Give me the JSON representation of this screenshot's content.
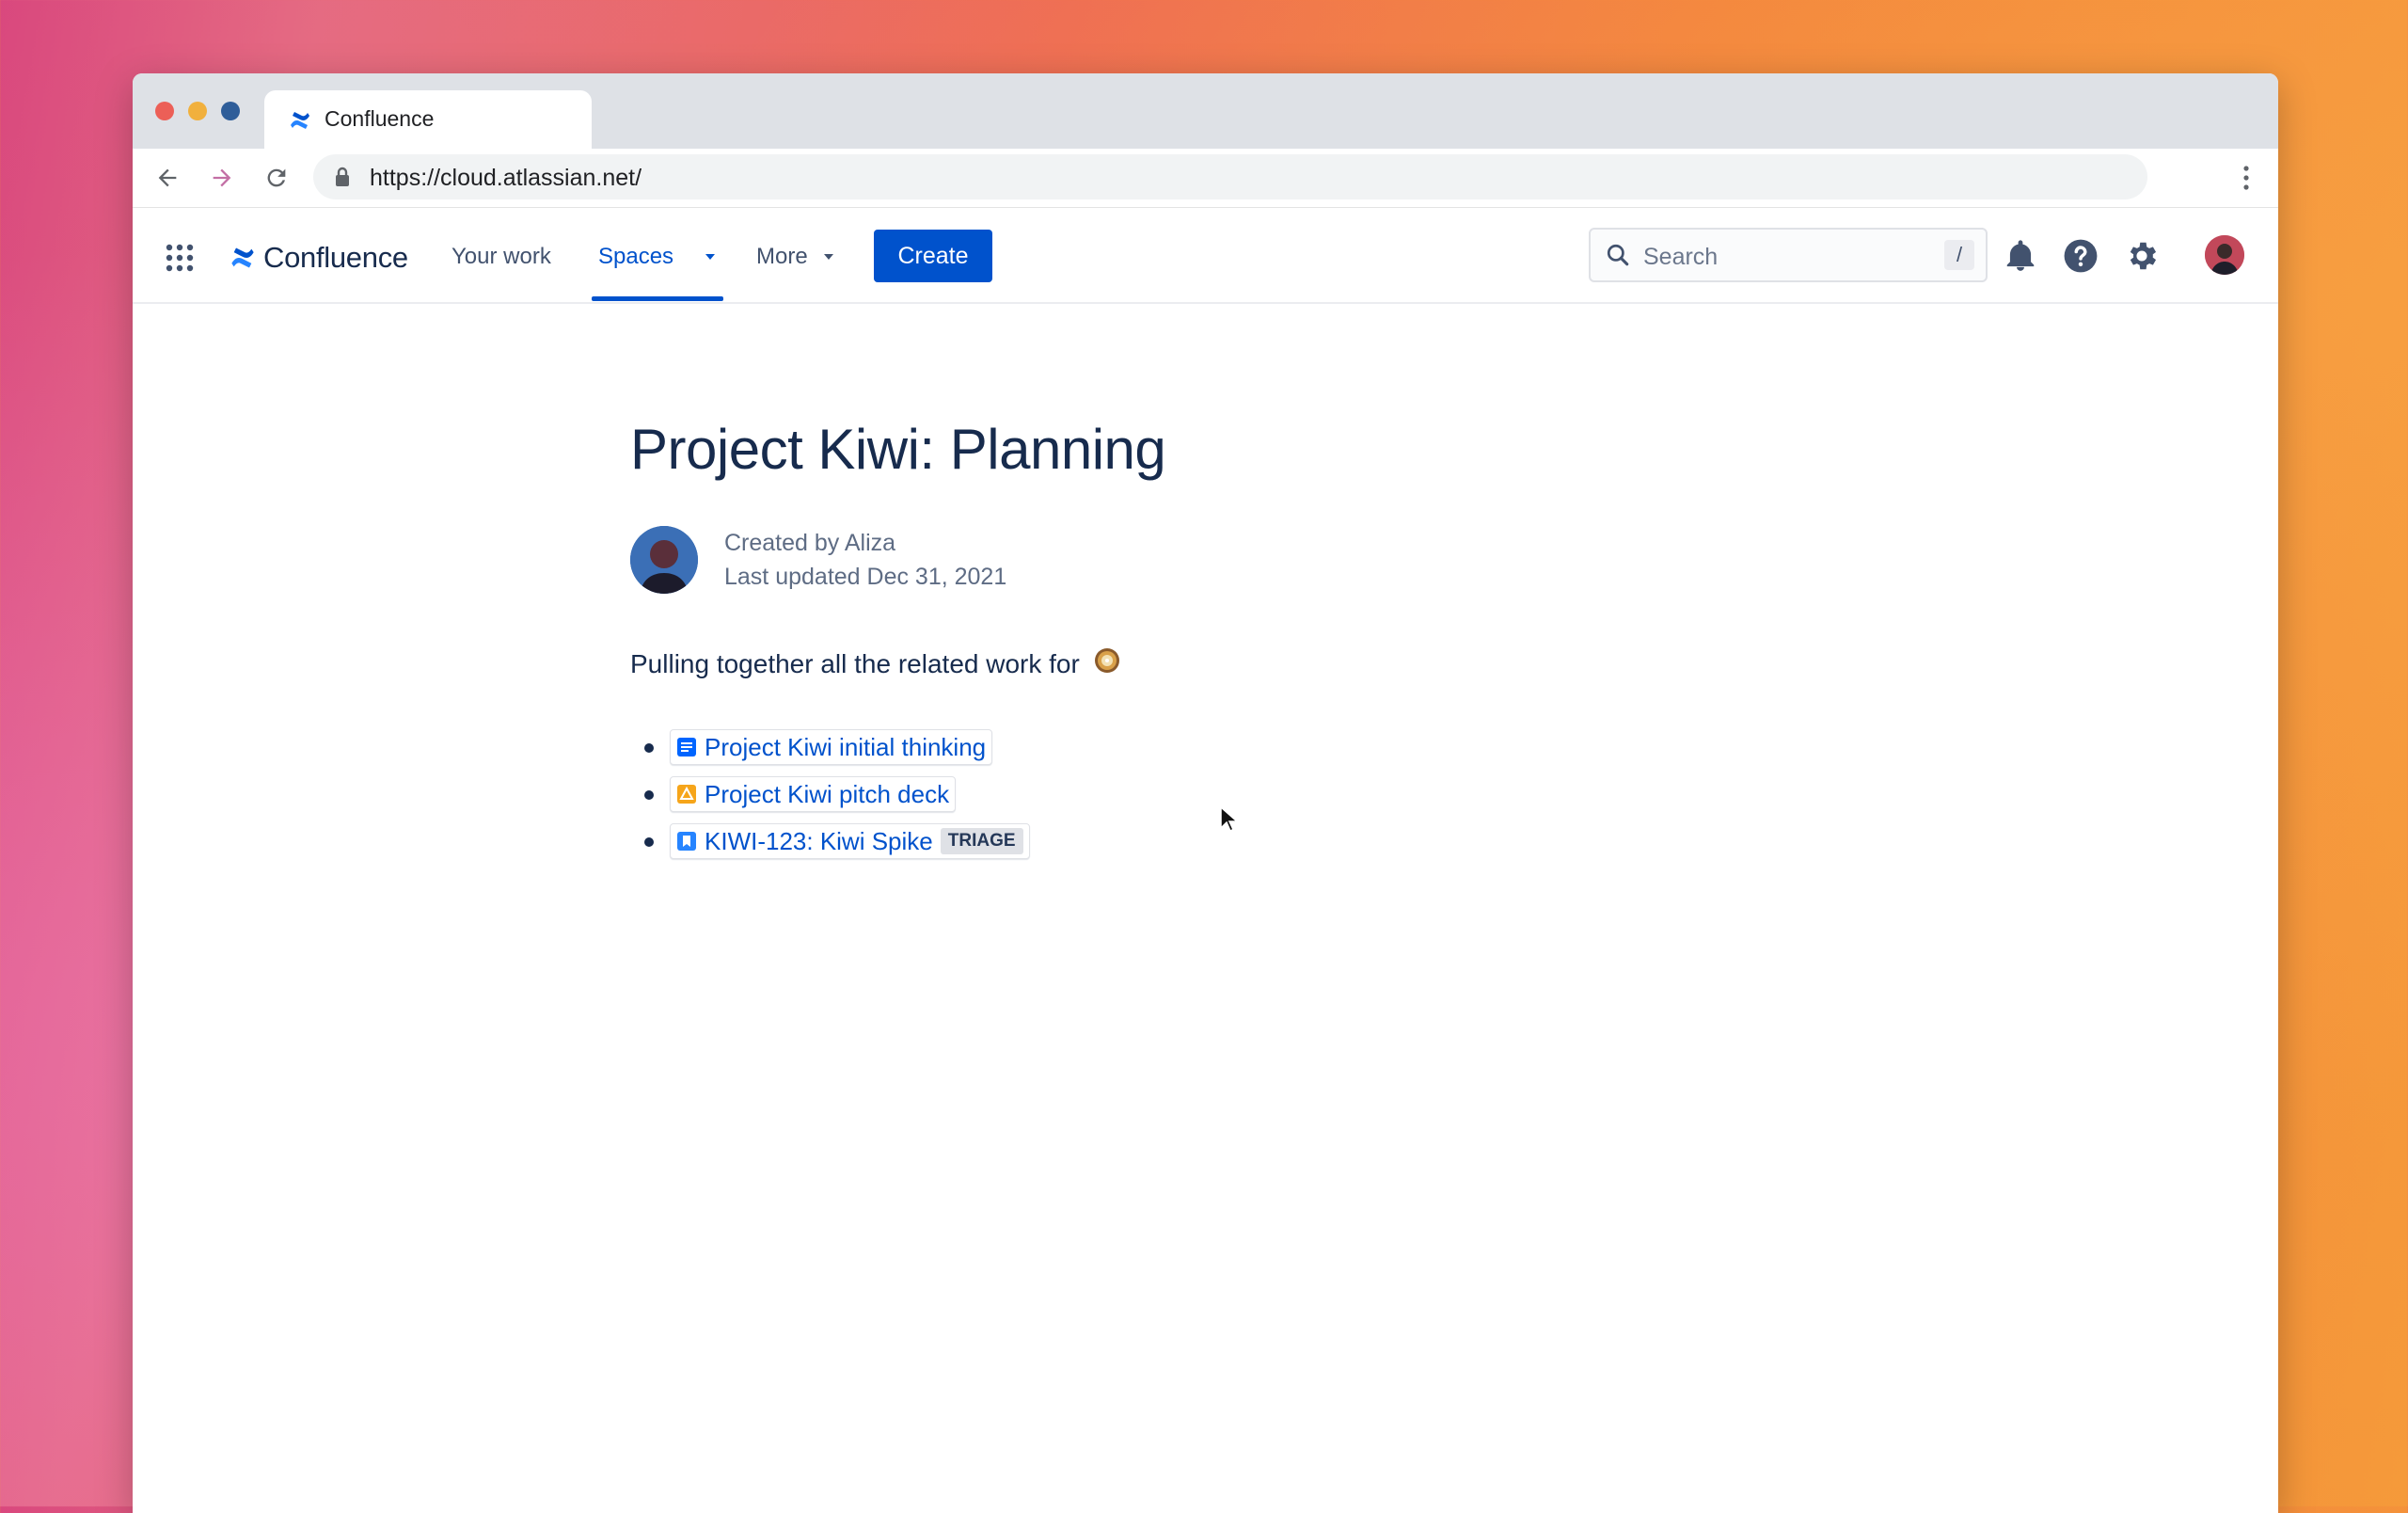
{
  "browser": {
    "tab_title": "Confluence",
    "url": "https://cloud.atlassian.net/",
    "traffic_colors": [
      "#ec5f57",
      "#f1b03d",
      "#2e5d99"
    ]
  },
  "nav": {
    "product_name": "Confluence",
    "items": [
      {
        "label": "Your work"
      },
      {
        "label": "Spaces",
        "active": true
      },
      {
        "label": "More"
      }
    ],
    "create_label": "Create",
    "search_placeholder": "Search",
    "search_shortcut": "/"
  },
  "page": {
    "title": "Project Kiwi: Planning",
    "created_by": "Created by Aliza",
    "last_updated": "Last updated Dec 31, 2021",
    "intro": "Pulling together all the related work for",
    "links": [
      {
        "icon": "page-icon",
        "label": "Project Kiwi initial thinking",
        "icon_color": "#0065ff"
      },
      {
        "icon": "google-slides-icon",
        "label": "Project Kiwi pitch deck",
        "icon_color": "#f6a51a"
      },
      {
        "icon": "jira-story-icon",
        "label": "KIWI-123: Kiwi Spike",
        "icon_color": "#2684ff",
        "status": "TRIAGE"
      }
    ]
  },
  "colors": {
    "accent": "#0052cc",
    "text": "#172b4d",
    "subtle": "#5e6c84"
  }
}
